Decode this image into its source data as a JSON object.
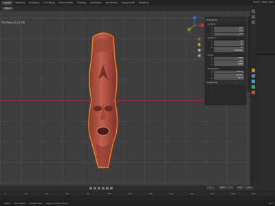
{
  "topbar": {
    "tabs": [
      "Layout",
      "Modeling",
      "Sculpting",
      "UV Editing",
      "Texture Paint",
      "Shading",
      "Animation",
      "Rendering",
      "Compositing",
      "Scripting"
    ],
    "scene_label": "Scene",
    "view_layer_label": "View Layer"
  },
  "viewport": {
    "mode_label": "Object",
    "object_title": "Tiki_Mask_01_LP_FIN"
  },
  "npanel": {
    "transform_header": "Transform",
    "location_label": "Location:",
    "location": [
      "X",
      "Y",
      "Z"
    ],
    "location_vals": [
      "0 m",
      "0 m",
      "0 m"
    ],
    "rotation_label": "Rotation:",
    "rotation": [
      "X",
      "Y",
      "Z"
    ],
    "rotation_vals": [
      "0°",
      "0°",
      "0°"
    ],
    "mode_label": "XYZ Euler",
    "scale_label": "Scale:",
    "scale": [
      "X",
      "Y",
      "Z"
    ],
    "scale_vals": [
      "1.000",
      "1.000",
      "1.000"
    ],
    "dimensions_label": "Dimensions:",
    "dimensions": [
      "X",
      "Y",
      "Z"
    ],
    "dimensions_vals": [
      "0.15 m",
      "0.14 m",
      "0.6 m"
    ],
    "properties_header": "Properties"
  },
  "timeline": {
    "start_label": "Start",
    "start_value": "1",
    "end_label": "End",
    "end_value": "250",
    "frame_value": "1",
    "ticks": [
      "0",
      "20",
      "40",
      "60",
      "80",
      "100",
      "120",
      "140",
      "160",
      "180",
      "200",
      "220",
      "240"
    ]
  },
  "status": {
    "select": "Select",
    "box_select": "Box Select",
    "rotate_view": "Rotate View",
    "object_context": "Object Context Menu",
    "version": "2.93"
  },
  "colors": {
    "mesh_fill": "#b55548",
    "mesh_outline": "#f07a1e",
    "x_axis": "#8a3535"
  }
}
